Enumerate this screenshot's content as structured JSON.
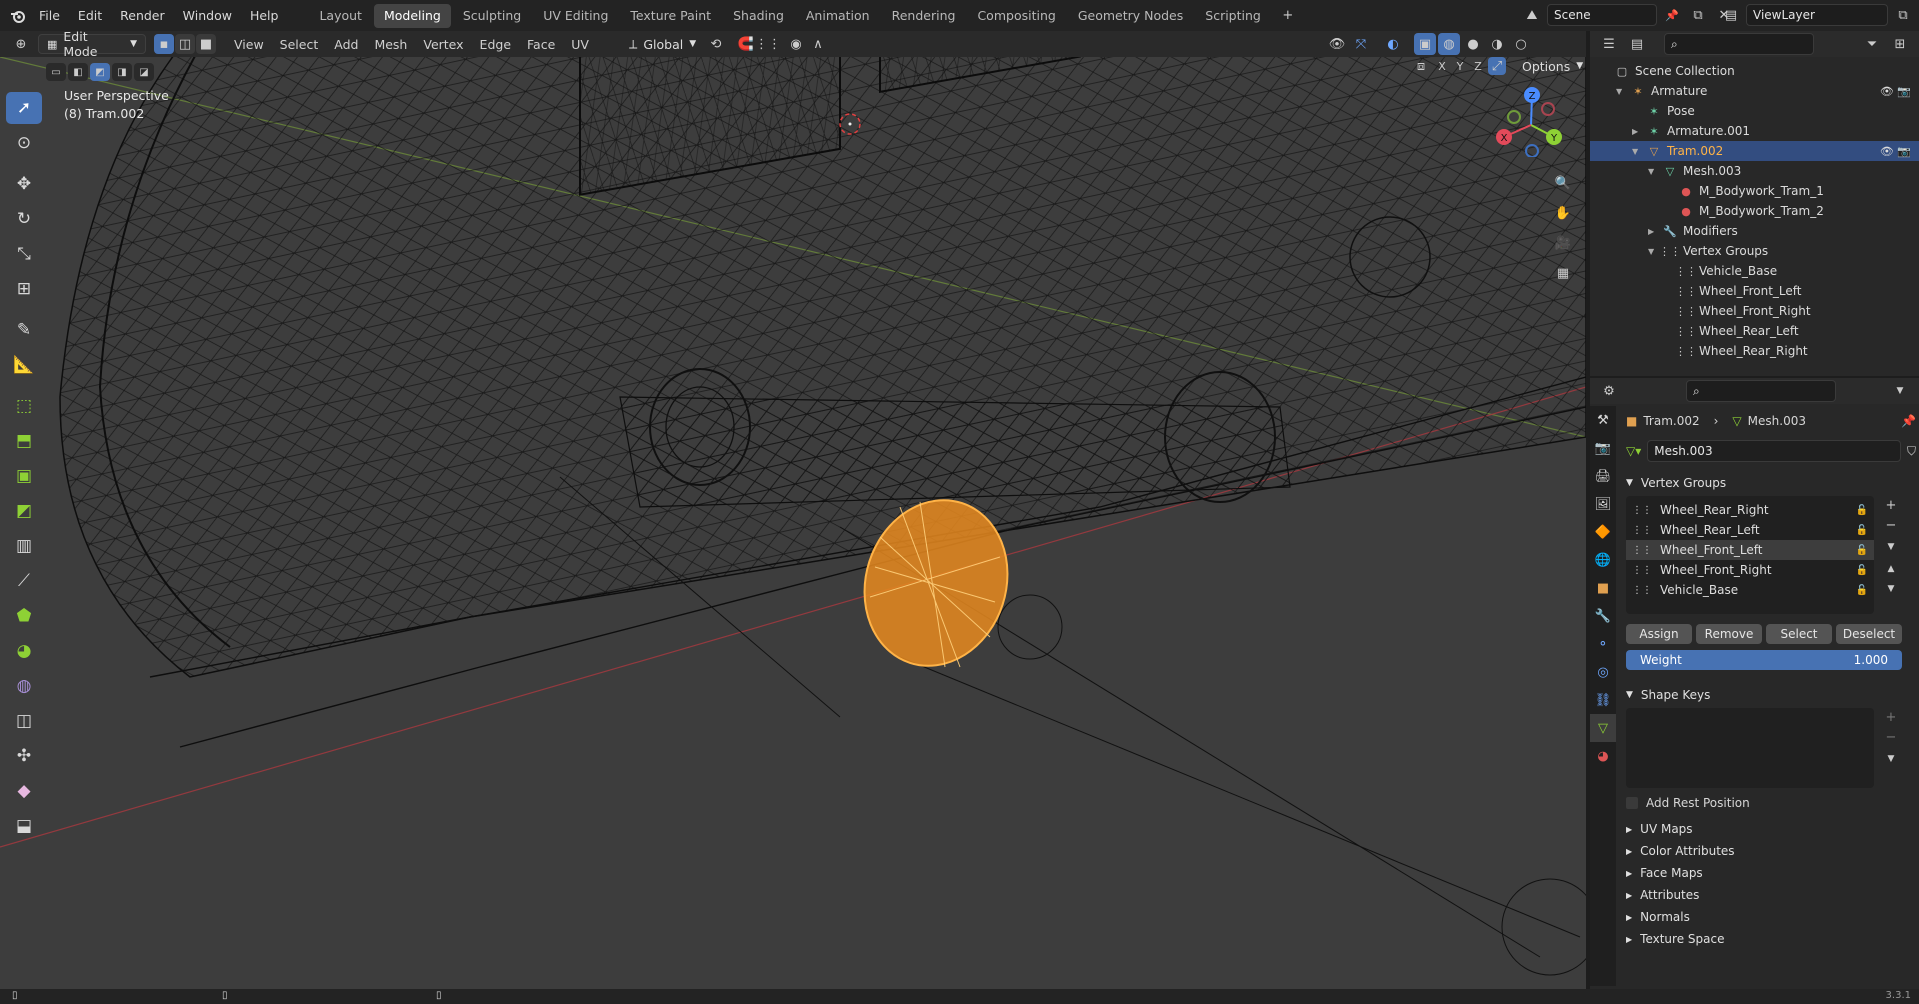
{
  "top_menu": [
    "File",
    "Edit",
    "Render",
    "Window",
    "Help"
  ],
  "workspaces": [
    "Layout",
    "Modeling",
    "Sculpting",
    "UV Editing",
    "Texture Paint",
    "Shading",
    "Animation",
    "Rendering",
    "Compositing",
    "Geometry Nodes",
    "Scripting"
  ],
  "active_workspace": "Modeling",
  "scene_name": "Scene",
  "view_layer": "ViewLayer",
  "viewport_header": {
    "mode": "Edit Mode",
    "menus": [
      "View",
      "Select",
      "Add",
      "Mesh",
      "Vertex",
      "Edge",
      "Face",
      "UV"
    ],
    "transform_orientation": "Global",
    "options_label": "Options",
    "axis_labels": [
      "X",
      "Y",
      "Z"
    ]
  },
  "viewport": {
    "perspective_label": "User Perspective",
    "object_label": "(8) Tram.002",
    "gizmo_axes": [
      "X",
      "Y",
      "Z"
    ]
  },
  "outliner": {
    "rows": [
      {
        "label": "Scene Collection",
        "depth": 0,
        "icon": "collection-icon",
        "sel": false
      },
      {
        "label": "Armature",
        "depth": 1,
        "icon": "armature-icon",
        "sel": false,
        "expanded": true,
        "vis": true
      },
      {
        "label": "Pose",
        "depth": 2,
        "icon": "pose-icon",
        "sel": false
      },
      {
        "label": "Armature.001",
        "depth": 2,
        "icon": "armature-data-icon",
        "sel": false,
        "collapsed": true
      },
      {
        "label": "Tram.002",
        "depth": 2,
        "icon": "mesh-object-icon",
        "sel": true,
        "expanded": true,
        "vis": true
      },
      {
        "label": "Mesh.003",
        "depth": 3,
        "icon": "mesh-data-icon",
        "sel": false,
        "expanded": true
      },
      {
        "label": "M_Bodywork_Tram_1",
        "depth": 4,
        "icon": "material-icon",
        "sel": false
      },
      {
        "label": "M_Bodywork_Tram_2",
        "depth": 4,
        "icon": "material-icon",
        "sel": false
      },
      {
        "label": "Modifiers",
        "depth": 3,
        "icon": "wrench-icon",
        "sel": false,
        "collapsed": true
      },
      {
        "label": "Vertex Groups",
        "depth": 3,
        "icon": "vertex-groups-icon",
        "sel": false,
        "expanded": true
      },
      {
        "label": "Vehicle_Base",
        "depth": 4,
        "icon": "vertex-group-icon",
        "sel": false
      },
      {
        "label": "Wheel_Front_Left",
        "depth": 4,
        "icon": "vertex-group-icon",
        "sel": false
      },
      {
        "label": "Wheel_Front_Right",
        "depth": 4,
        "icon": "vertex-group-icon",
        "sel": false
      },
      {
        "label": "Wheel_Rear_Left",
        "depth": 4,
        "icon": "vertex-group-icon",
        "sel": false
      },
      {
        "label": "Wheel_Rear_Right",
        "depth": 4,
        "icon": "vertex-group-icon",
        "sel": false
      }
    ]
  },
  "properties": {
    "breadcrumb_object": "Tram.002",
    "breadcrumb_data": "Mesh.003",
    "data_name": "Mesh.003",
    "vertex_groups_title": "Vertex Groups",
    "vertex_groups": [
      "Wheel_Rear_Right",
      "Wheel_Rear_Left",
      "Wheel_Front_Left",
      "Wheel_Front_Right",
      "Vehicle_Base"
    ],
    "selected_group": "Wheel_Front_Left",
    "buttons": {
      "assign": "Assign",
      "remove": "Remove",
      "select": "Select",
      "deselect": "Deselect"
    },
    "weight_label": "Weight",
    "weight_value": "1.000",
    "shape_keys_title": "Shape Keys",
    "add_rest_position": "Add Rest Position",
    "collapsed_panels": [
      "UV Maps",
      "Color Attributes",
      "Face Maps",
      "Attributes",
      "Normals",
      "Texture Space"
    ]
  },
  "status_version": "3.3.1",
  "colors": {
    "accent": "#4772b3",
    "selection": "#ff9a1f",
    "selected_row": "#334d80"
  }
}
